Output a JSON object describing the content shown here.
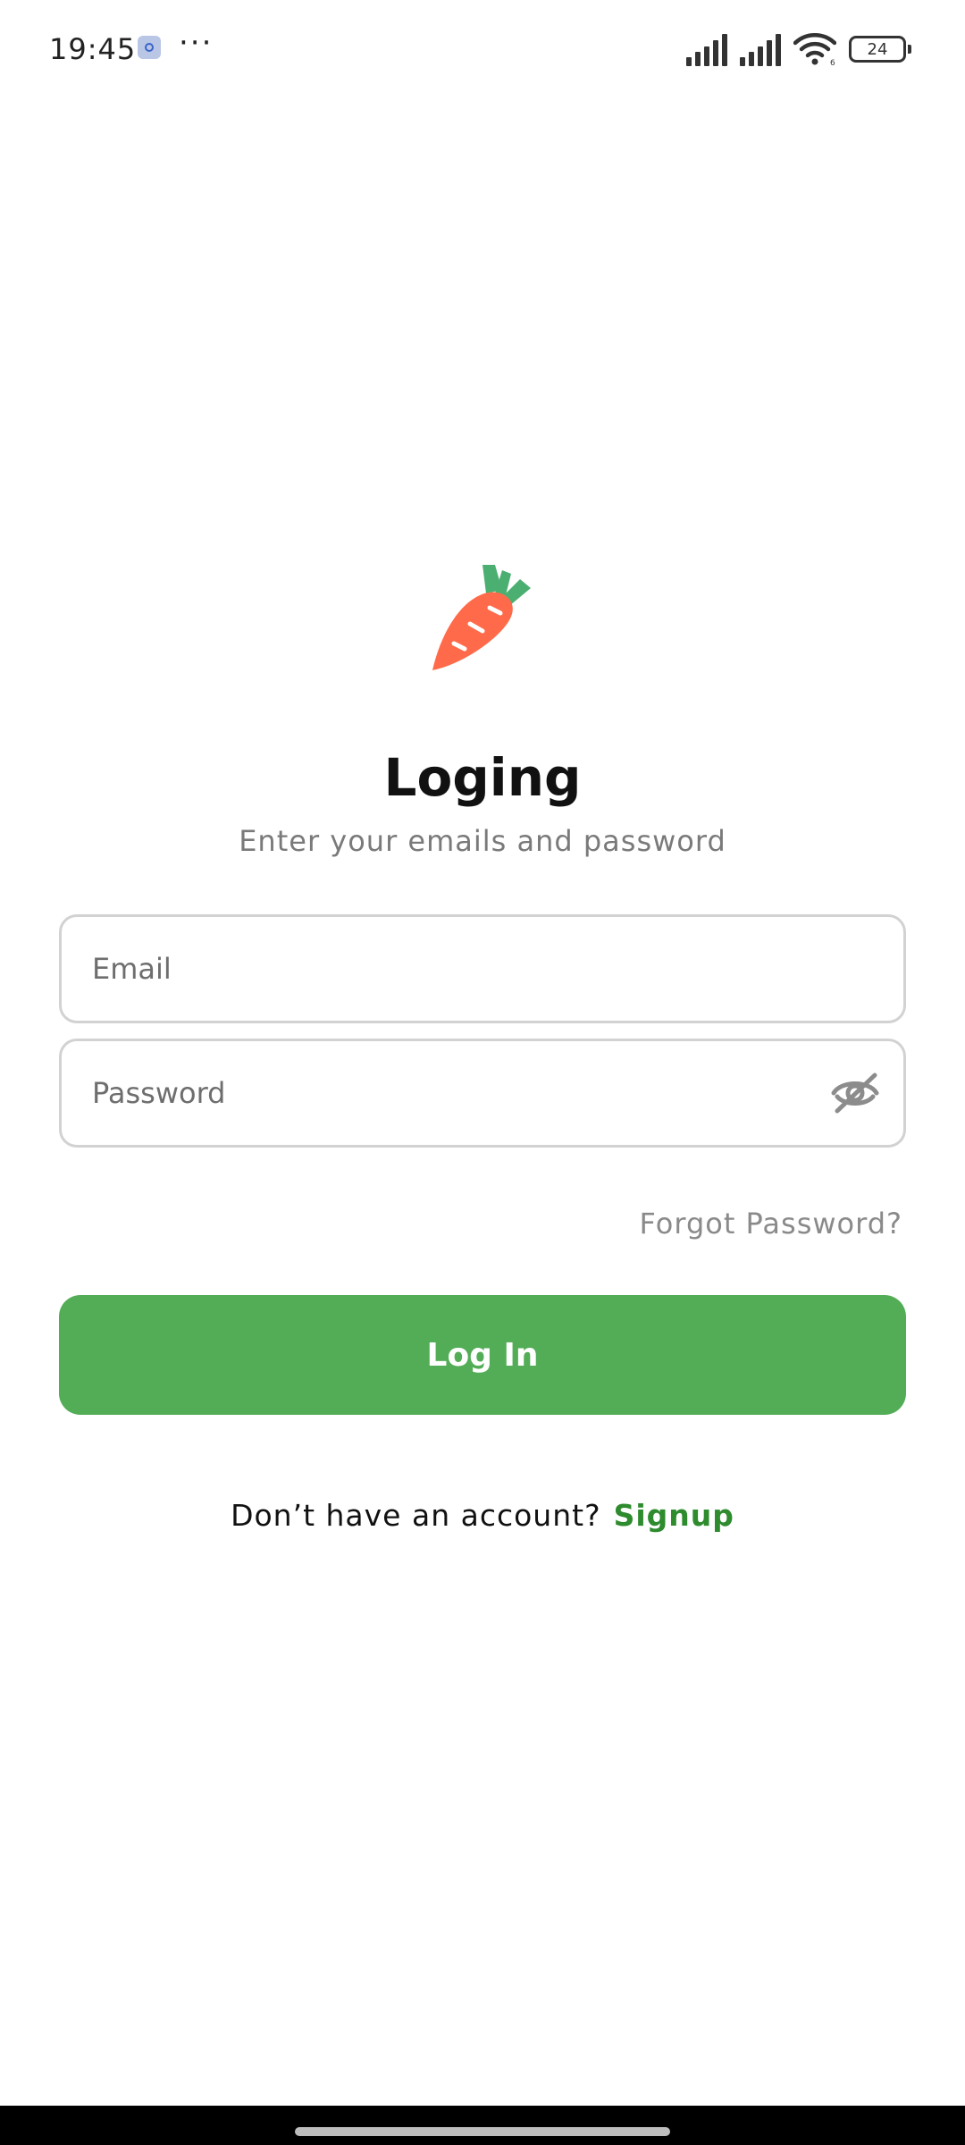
{
  "status_bar": {
    "time": "19:45",
    "more": "···",
    "battery_level": "24",
    "wifi_badge": "6",
    "icons": [
      "notification-app-icon",
      "signal-icon",
      "signal-icon",
      "wifi-icon",
      "battery-icon"
    ]
  },
  "logo": {
    "icon": "carrot-icon",
    "colors": {
      "body": "#ff6b4a",
      "leaves": "#4caf72"
    }
  },
  "screen": {
    "title": "Loging",
    "subtitle": "Enter your emails and password"
  },
  "form": {
    "email": {
      "placeholder": "Email",
      "value": ""
    },
    "password": {
      "placeholder": "Password",
      "value": "",
      "toggle_icon": "eye-off-icon"
    },
    "forgot_label": "Forgot Password?",
    "submit_label": "Log In"
  },
  "signup": {
    "prompt": "Don’t have an account?",
    "link_label": "Signup"
  },
  "colors": {
    "primary": "#52ad56",
    "link": "#2e8b2e",
    "muted_text": "#7a7a7a",
    "border": "#d2d2d2"
  }
}
